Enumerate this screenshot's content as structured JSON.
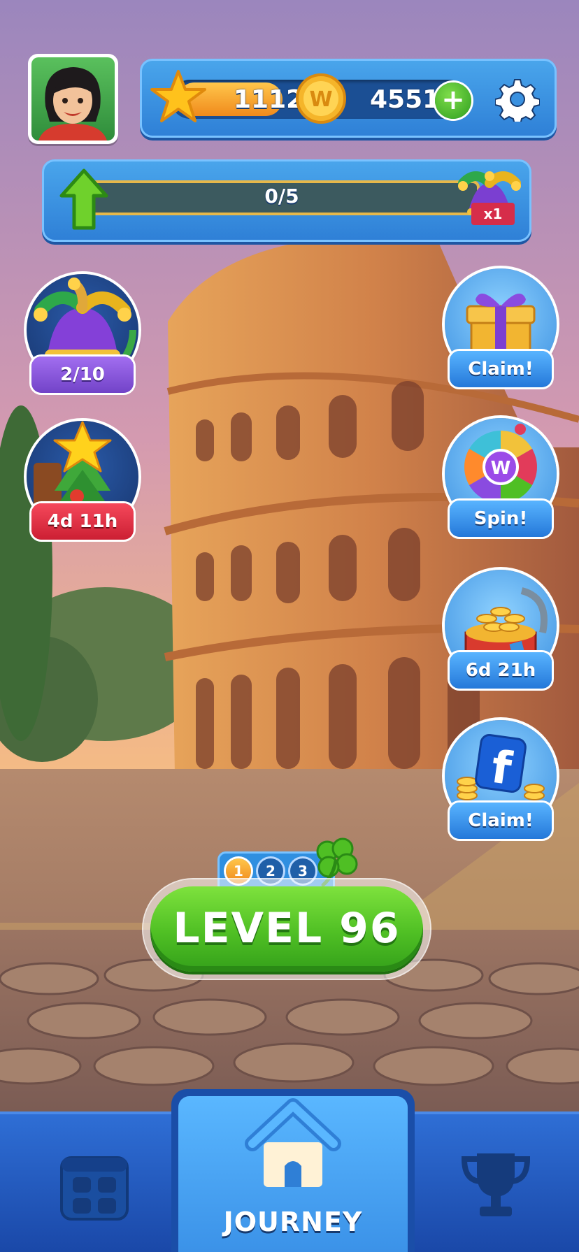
{
  "header": {
    "avatar_icon": "player-avatar",
    "stars": "1112",
    "coins": "45512",
    "add_coins_icon": "plus-icon",
    "settings_icon": "gear-icon"
  },
  "progress": {
    "label": "0/5",
    "fraction": 0.0,
    "multiplier": "x1",
    "reward_icon": "jester-hat-icon"
  },
  "left_events": [
    {
      "name": "jester-event",
      "icon": "jester-hat-icon",
      "badge": "2/10"
    },
    {
      "name": "christmas-event",
      "icon": "christmas-tree-icon",
      "badge": "4d 11h"
    }
  ],
  "right_events": [
    {
      "name": "gift-claim",
      "icon": "gift-box-icon",
      "badge": "Claim!"
    },
    {
      "name": "wheel-spin",
      "icon": "prize-wheel-icon",
      "badge": "Spin!"
    },
    {
      "name": "coin-chest",
      "icon": "coin-chest-icon",
      "badge": "6d 21h"
    },
    {
      "name": "facebook-claim",
      "icon": "facebook-icon",
      "badge": "Claim!"
    }
  ],
  "level": {
    "label": "LEVEL 96",
    "steps": [
      "1",
      "2",
      "3"
    ],
    "active_step": 1,
    "bonus_icon": "clover-icon"
  },
  "nav": {
    "left_icon": "calendar-icon",
    "center_label": "JOURNEY",
    "center_icon": "home-icon",
    "right_icon": "trophy-icon"
  },
  "colors": {
    "sky_top": "#9b7fb8",
    "sky_bottom": "#f5b56a",
    "panel_blue": "#3a91e0",
    "level_green": "#4fbf24"
  }
}
